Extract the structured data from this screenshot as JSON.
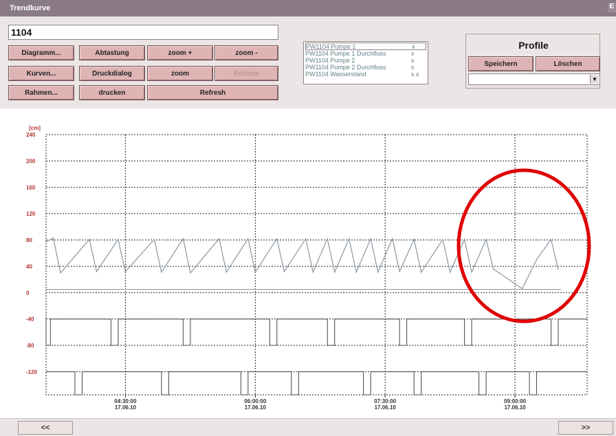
{
  "window": {
    "title": "Trendkurve",
    "corner_glyph": "E"
  },
  "station_id": "1104",
  "buttons": {
    "diagramm": "Diagramm...",
    "abtastung": "Abtastung",
    "zoom_plus": "zoom +",
    "zoom_minus": "zoom -",
    "kurven": "Kurven...",
    "druckdialog": "Druckdialog",
    "zoom": "zoom",
    "rezoom": "Rezoom",
    "rahmen": "Rahmen...",
    "drucken": "drucken",
    "refresh": "Refresh"
  },
  "legend": [
    {
      "name": "PW1104 Pumpe 1",
      "mark": "x"
    },
    {
      "name": "PW1104 Pumpe 1 Durchfluss",
      "mark": "x"
    },
    {
      "name": "PW1104 Pumpe 2",
      "mark": "x"
    },
    {
      "name": "PW1104 Pumpe 2 Durchfluss",
      "mark": "x"
    },
    {
      "name": "PW1104 Wasserstand",
      "mark": "x x"
    }
  ],
  "profile": {
    "title": "Profile",
    "save": "Speichern",
    "delete": "Löschen",
    "selected": ""
  },
  "navigation": {
    "prev": "<<",
    "next": ">>"
  },
  "colors": {
    "titlebar": "#8a7a86",
    "button": "#dfb4b4",
    "curve": "#8a95a0",
    "axis_label": "#b03030"
  },
  "chart_data": {
    "type": "line",
    "y_unit": "[cm]",
    "y_ticks": [
      240,
      200,
      160,
      120,
      80,
      40,
      0,
      -40,
      -80,
      -120
    ],
    "ylim": [
      -155,
      240
    ],
    "x_ticks": [
      {
        "time": "04:30:00",
        "date": "17.06.10"
      },
      {
        "time": "06:00:00",
        "date": "17.06.10"
      },
      {
        "time": "07:30:00",
        "date": "17.06.10"
      },
      {
        "time": "09:00:00",
        "date": "17.06.10"
      }
    ],
    "xlim": [
      "03:35",
      "09:50"
    ],
    "grid": true,
    "series": [
      {
        "name": "PW1104 Wasserstand",
        "points": [
          [
            "03:35",
            77
          ],
          [
            "03:40",
            83
          ],
          [
            "03:45",
            30
          ],
          [
            "04:05",
            81
          ],
          [
            "04:10",
            32
          ],
          [
            "04:25",
            81
          ],
          [
            "04:30",
            32
          ],
          [
            "04:50",
            81
          ],
          [
            "04:55",
            31
          ],
          [
            "05:10",
            82
          ],
          [
            "05:15",
            30
          ],
          [
            "05:35",
            82
          ],
          [
            "05:40",
            31
          ],
          [
            "05:55",
            82
          ],
          [
            "06:00",
            31
          ],
          [
            "06:15",
            82
          ],
          [
            "06:20",
            32
          ],
          [
            "06:35",
            82
          ],
          [
            "06:40",
            31
          ],
          [
            "06:50",
            82
          ],
          [
            "06:55",
            31
          ],
          [
            "07:05",
            82
          ],
          [
            "07:10",
            31
          ],
          [
            "07:20",
            82
          ],
          [
            "07:25",
            31
          ],
          [
            "07:35",
            82
          ],
          [
            "07:40",
            32
          ],
          [
            "07:50",
            81
          ],
          [
            "07:55",
            31
          ],
          [
            "08:10",
            81
          ],
          [
            "08:15",
            31
          ],
          [
            "08:25",
            81
          ],
          [
            "08:30",
            31
          ],
          [
            "08:40",
            81
          ],
          [
            "08:45",
            36
          ],
          [
            "09:05",
            6
          ],
          [
            "09:15",
            50
          ],
          [
            "09:25",
            81
          ],
          [
            "09:30",
            35
          ]
        ]
      },
      {
        "name": "PW1104 Pumpe 1",
        "baseline": -40,
        "pulse_level": -80,
        "pulses": [
          [
            "03:35",
            "03:38"
          ],
          [
            "04:20",
            "04:25"
          ],
          [
            "05:10",
            "05:15"
          ],
          [
            "06:10",
            "06:15"
          ],
          [
            "06:50",
            "06:55"
          ],
          [
            "07:40",
            "07:45"
          ],
          [
            "08:25",
            "08:30"
          ],
          [
            "09:25",
            "09:30"
          ]
        ]
      },
      {
        "name": "PW1104 Pumpe 2",
        "baseline": -120,
        "pulse_level": -155,
        "pulses": [
          [
            "03:55",
            "04:00"
          ],
          [
            "04:55",
            "05:00"
          ],
          [
            "05:50",
            "05:55"
          ],
          [
            "06:25",
            "06:30"
          ],
          [
            "07:15",
            "07:20"
          ],
          [
            "07:50",
            "07:55"
          ],
          [
            "08:35",
            "08:40"
          ],
          [
            "09:10",
            "09:15"
          ]
        ]
      },
      {
        "name": "PW1104 Pumpe 1 Durchfluss",
        "constant": 5
      }
    ]
  }
}
